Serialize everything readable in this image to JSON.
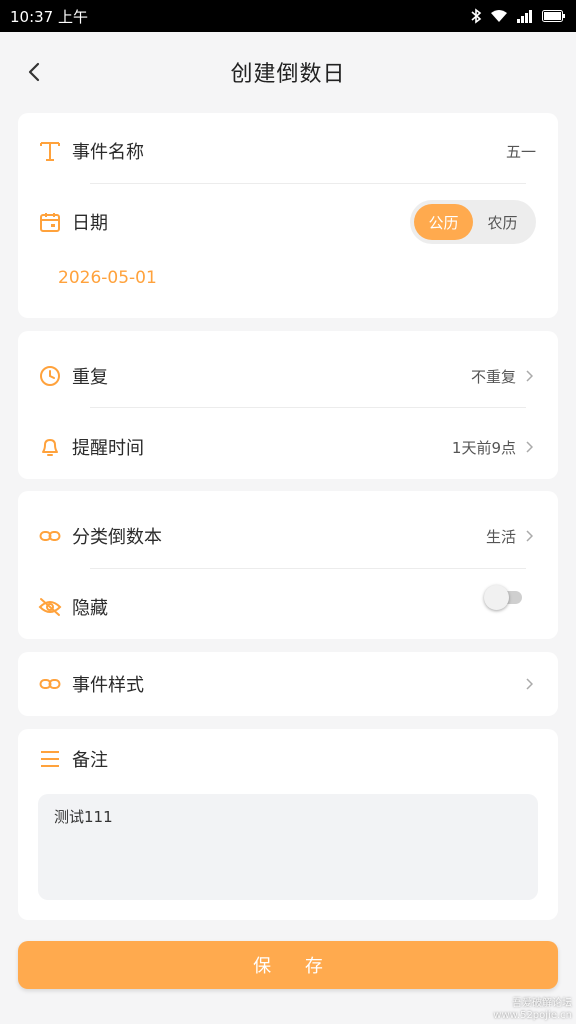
{
  "status_bar": {
    "time": "10:37 上午",
    "battery": "battery-icon",
    "wifi": "wifi-icon",
    "signal": "signal-icon",
    "bluetooth": "bluetooth-icon"
  },
  "header": {
    "title": "创建倒数日",
    "back_icon": "back-arrow-icon"
  },
  "event_card": {
    "name_label": "事件名称",
    "name_value": "五一",
    "date_label": "日期",
    "calendar_options": [
      "公历",
      "农历"
    ],
    "selected_calendar": "公历",
    "date_value": "2026-05-01"
  },
  "repeat_card": {
    "repeat_label": "重复",
    "repeat_value": "不重复",
    "reminder_label": "提醒时间",
    "reminder_value": "1天前9点"
  },
  "category_card": {
    "category_label": "分类倒数本",
    "category_value": "生活",
    "hide_label": "隐藏",
    "hide_enabled": false
  },
  "style_card": {
    "style_label": "事件样式"
  },
  "note_card": {
    "note_label": "备注",
    "note_value": "测试111"
  },
  "save_label": "保 存",
  "watermark": {
    "line1": "吾爱破解论坛",
    "line2": "www.52pojie.cn"
  },
  "colors": {
    "accent": "#ffaa4e",
    "date_text": "#ffa23c",
    "background": "#f5f5f6",
    "card": "#ffffff"
  }
}
